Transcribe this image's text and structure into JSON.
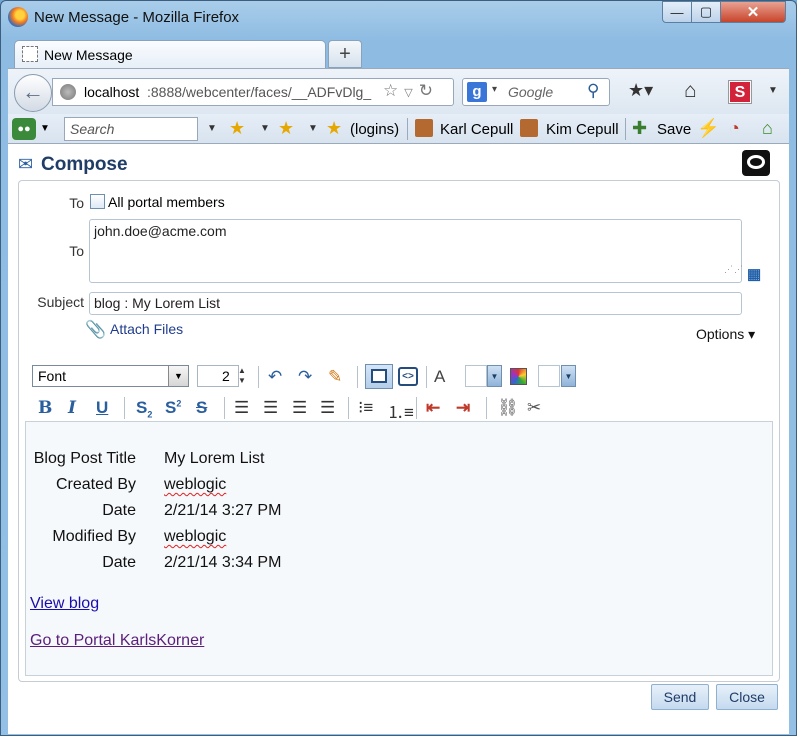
{
  "window": {
    "title": "New Message - Mozilla Firefox",
    "minimize": "—",
    "maximize": "▢",
    "close": "✕"
  },
  "tabs": [
    {
      "label": "New Message"
    }
  ],
  "new_tab": "+",
  "nav": {
    "url_host": "localhost",
    "url_rest": ":8888/webcenter/faces/__ADFvDlg_",
    "search_engine": "g",
    "search_placeholder": "Google"
  },
  "toolbar2": {
    "search_placeholder": "Search",
    "logins_label": "(logins)",
    "user1": "Karl Cepull",
    "user2": "Kim Cepull",
    "save_label": "Save"
  },
  "compose": {
    "title": "Compose",
    "to_label_1": "To",
    "all_members_label": "All portal members",
    "all_members_checked": false,
    "to_label_2": "To",
    "to_value": "john.doe@acme.com",
    "subject_label": "Subject",
    "subject_value": "blog : My Lorem List",
    "attach_label": "Attach Files",
    "options_label": "Options ▾"
  },
  "editor_toolbar": {
    "font_value": "Font",
    "size_value": "2"
  },
  "editor_body": {
    "rows": [
      {
        "label": "Blog Post Title",
        "value": "My Lorem List"
      },
      {
        "label": "Created By",
        "value": "weblogic"
      },
      {
        "label": "Date",
        "value": "2/21/14 3:27 PM"
      },
      {
        "label": "Modified By",
        "value": "weblogic"
      },
      {
        "label": "Date",
        "value": "2/21/14 3:34 PM"
      }
    ],
    "link_view": "View blog",
    "link_portal": "Go to Portal KarlsKorner"
  },
  "footer": {
    "send_label": "Send",
    "close_label": "Close"
  },
  "colors": {
    "accent": "#1f3d66",
    "link": "#1a0dab",
    "visited_link": "#5b1f7a"
  }
}
